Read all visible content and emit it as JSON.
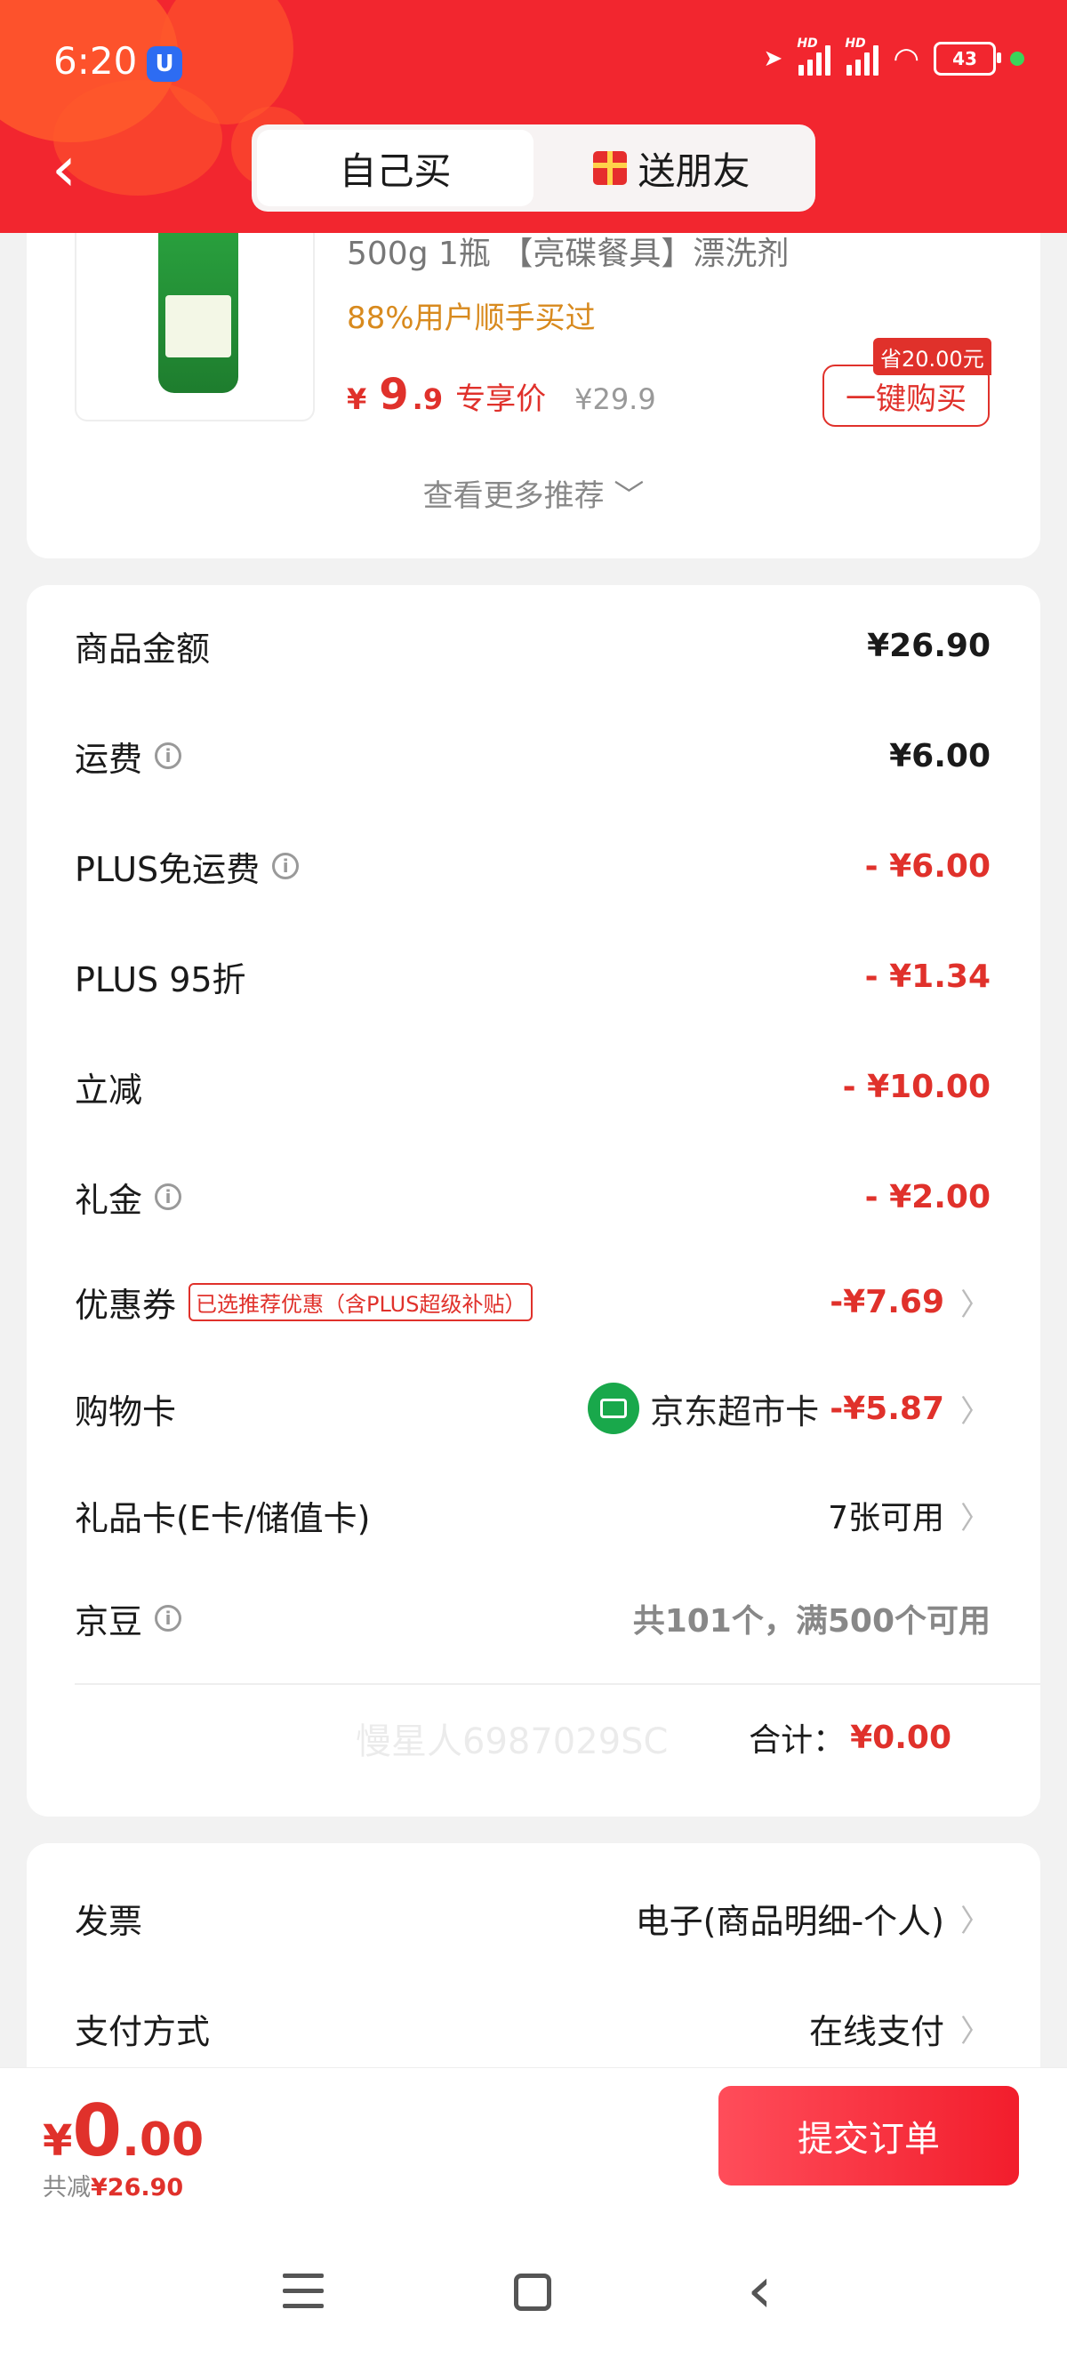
{
  "status_bar": {
    "time": "6:20",
    "app_badge": "U",
    "battery": "43",
    "sig1_hd": "HD",
    "sig2_hd": "HD"
  },
  "header": {
    "tab_self": "自己买",
    "tab_gift": "送朋友"
  },
  "product": {
    "title": "500g 1瓶 【亮碟餐具】漂洗剂",
    "sales_note": "88%用户顺手买过",
    "price_currency": "¥",
    "price_int": "9",
    "price_dec": ".9",
    "price_tag": "专享价",
    "price_original": "¥29.9",
    "save_badge": "省20.00元",
    "buy_button": "一键购买",
    "more_recommend": "查看更多推荐",
    "more_chevron": "﹀"
  },
  "summary": {
    "rows": [
      {
        "label": "商品金额",
        "value": "¥26.90"
      },
      {
        "label": "运费",
        "value": "¥6.00"
      },
      {
        "label": "PLUS免运费",
        "value": "- ¥6.00"
      },
      {
        "label": "PLUS 95折",
        "value": "- ¥1.34"
      },
      {
        "label": "立减",
        "value": "- ¥10.00"
      },
      {
        "label": "礼金",
        "value": "- ¥2.00"
      },
      {
        "label": "优惠券",
        "tag": "已选推荐优惠（含PLUS超级补贴）",
        "value": "-¥7.69"
      },
      {
        "label": "购物卡",
        "card_name": "京东超市卡",
        "value": "-¥5.87"
      },
      {
        "label": "礼品卡(E卡/储值卡)",
        "value": "7张可用"
      },
      {
        "label": "京豆",
        "value": "共101个，满500个可用"
      }
    ],
    "total_label": "合计：",
    "total_value": "¥0.00",
    "watermark": "慢星人6987029SC"
  },
  "invoice": {
    "invoice_label": "发票",
    "invoice_value": "电子(商品明细-个人)",
    "payment_label": "支付方式",
    "payment_value": "在线支付"
  },
  "bottom": {
    "currency": "¥",
    "amount_int": "0",
    "amount_dec": ".00",
    "saved_label": "共减",
    "saved_value": "¥26.90",
    "submit": "提交订单"
  },
  "chevron": "〉",
  "colors": {
    "brand_red": "#f2262f",
    "price_red": "#e0312b",
    "sales_orange": "#d88a1e",
    "jd_green": "#19a84b"
  }
}
